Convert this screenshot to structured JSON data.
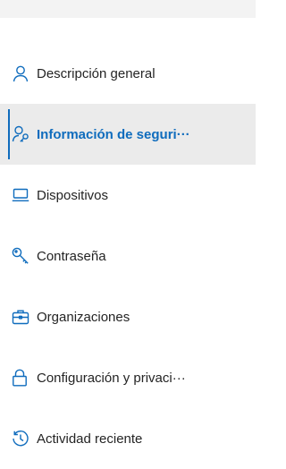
{
  "nav": {
    "items": [
      {
        "label": "Descripción general",
        "icon": "person-icon"
      },
      {
        "label": "Información de seguri···",
        "icon": "person-key-icon",
        "active": true
      },
      {
        "label": "Dispositivos",
        "icon": "laptop-icon"
      },
      {
        "label": "Contraseña",
        "icon": "key-icon"
      },
      {
        "label": "Organizaciones",
        "icon": "briefcase-icon"
      },
      {
        "label": "Configuración y privaci···",
        "icon": "lock-icon"
      },
      {
        "label": "Actividad reciente",
        "icon": "history-icon"
      }
    ]
  },
  "colors": {
    "accent": "#0f6cbd",
    "active_background": "#ebebeb",
    "text": "#242424",
    "topbar": "#f3f3f3"
  }
}
